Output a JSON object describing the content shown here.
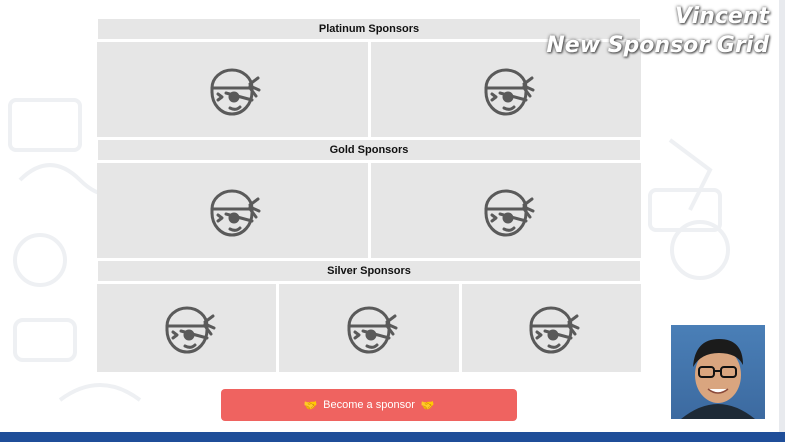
{
  "tiers": [
    {
      "label": "Platinum Sponsors",
      "slots": 2
    },
    {
      "label": "Gold Sponsors",
      "slots": 2
    },
    {
      "label": "Silver Sponsors",
      "slots": 3
    }
  ],
  "sponsor_icon": "pirate-bandana-icon",
  "cta": {
    "label": "Become a sponsor",
    "icon": "handshake-emoji",
    "color": "#ef6360"
  },
  "overlay": {
    "line1": "Vincent",
    "line2": "New Sponsor Grid"
  },
  "webcam": {
    "content": "presenter-webcam"
  },
  "colors": {
    "cell_bg": "#e6e6e6",
    "bottom_bar": "#1f4e99",
    "cta": "#ef6360"
  }
}
